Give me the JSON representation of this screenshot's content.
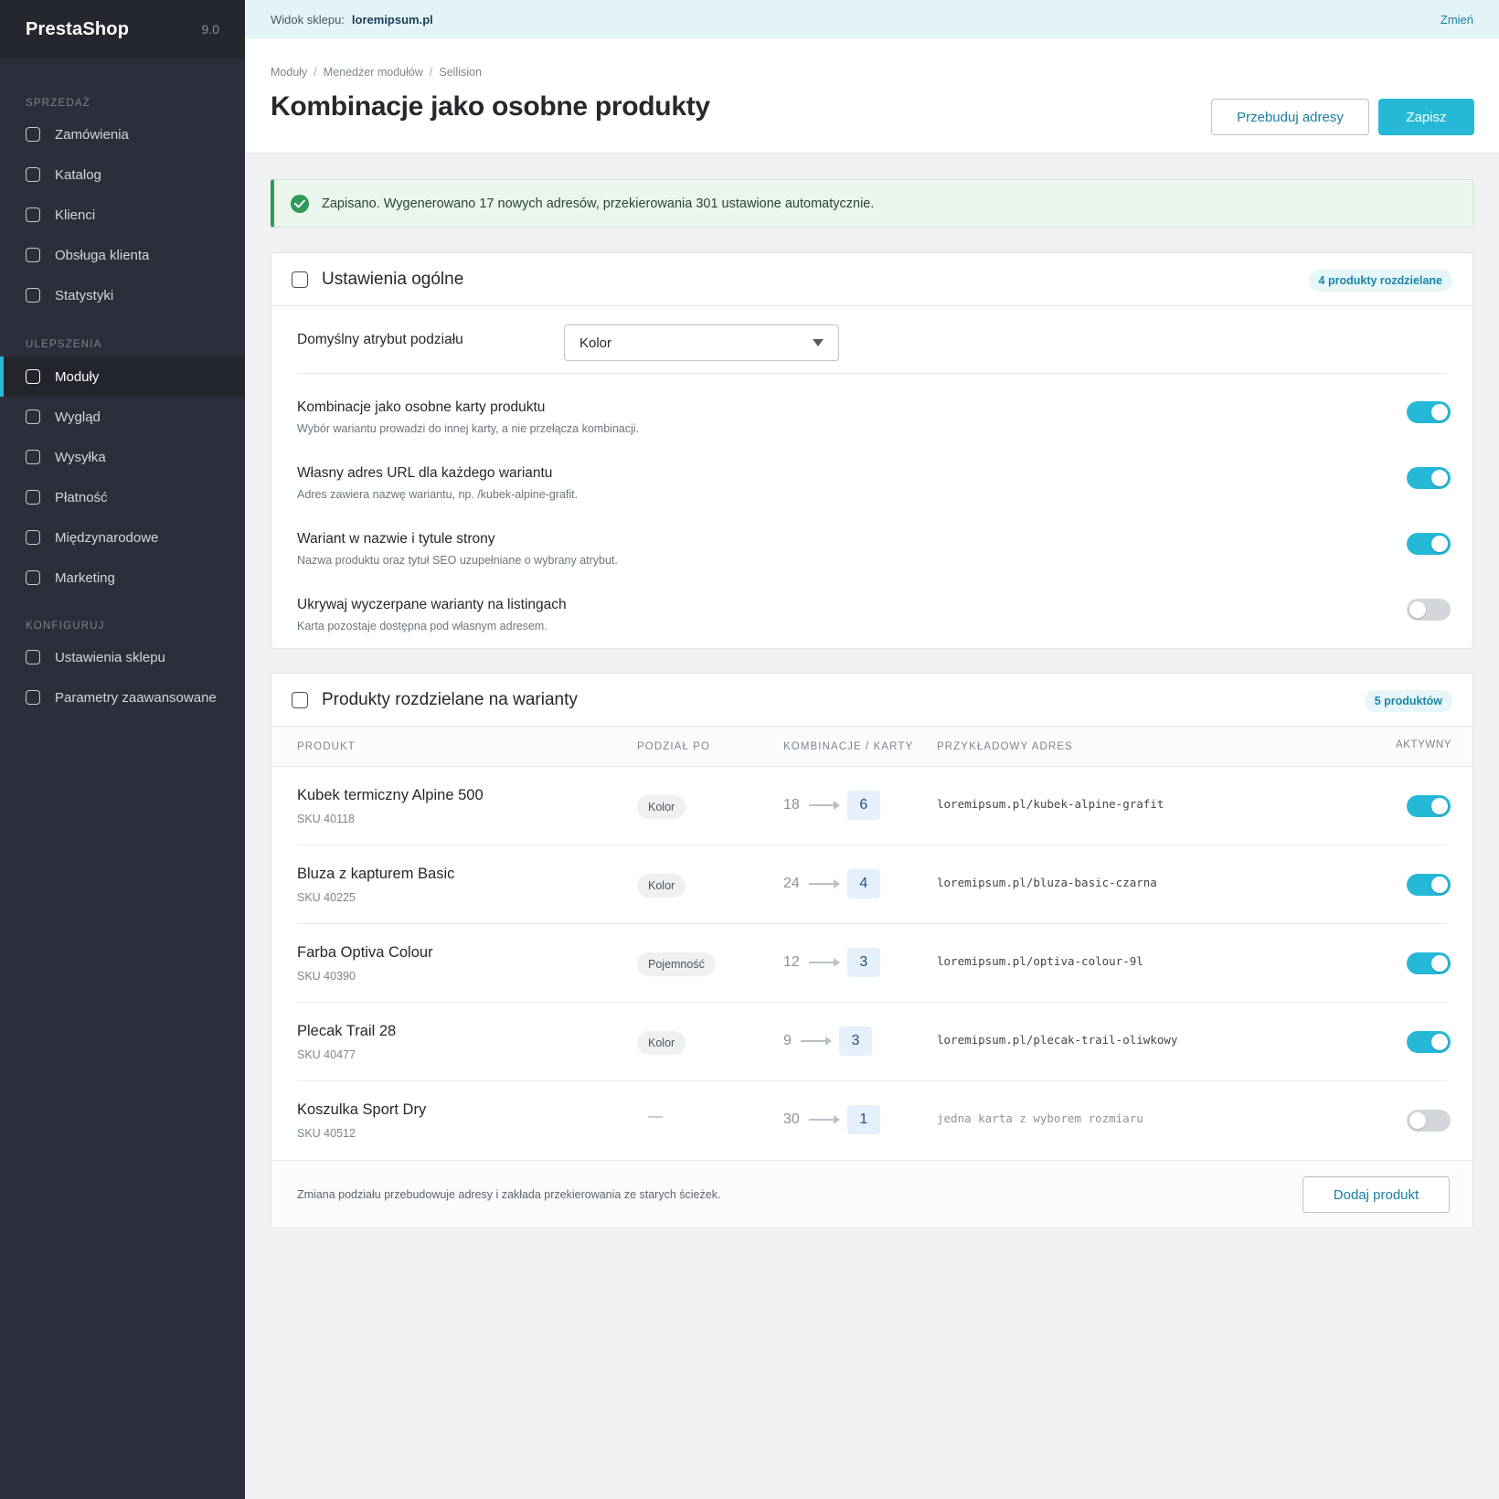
{
  "sidebar": {
    "brand": "PrestaShop",
    "version": "9.0",
    "sections": [
      {
        "title": "SPRZEDAŻ",
        "items": [
          "Zamówienia",
          "Katalog",
          "Klienci",
          "Obsługa klienta",
          "Statystyki"
        ]
      },
      {
        "title": "ULEPSZENIA",
        "items": [
          "Moduły",
          "Wygląd",
          "Wysyłka",
          "Płatność",
          "Międzynarodowe",
          "Marketing"
        ]
      },
      {
        "title": "KONFIGURUJ",
        "items": [
          "Ustawienia sklepu",
          "Parametry zaawansowane"
        ]
      }
    ],
    "active_item": "Moduły"
  },
  "topbar": {
    "label": "Widok sklepu:",
    "domain": "loremipsum.pl",
    "change": "Zmień"
  },
  "header": {
    "breadcrumb": [
      "Moduły",
      "Menedżer modułów",
      "Sellision"
    ],
    "title": "Kombinacje jako osobne produkty",
    "rebuild_button": "Przebuduj adresy",
    "save_button": "Zapisz"
  },
  "alert": {
    "text": "Zapisano. Wygenerowano 17 nowych adresów, przekierowania 301 ustawione automatycznie.",
    "color": "#2f9a5a"
  },
  "general": {
    "title": "Ustawienia ogólne",
    "badge": "4 produkty rozdzielane",
    "attribute_label": "Domyślny atrybut podziału",
    "attribute_value": "Kolor",
    "settings": [
      {
        "label": "Kombinacje jako osobne karty produktu",
        "desc": "Wybór wariantu prowadzi do innej karty, a nie przełącza kombinacji.",
        "enabled": true
      },
      {
        "label": "Własny adres URL dla każdego wariantu",
        "desc": "Adres zawiera nazwę wariantu, np. /kubek-alpine-grafit.",
        "enabled": true
      },
      {
        "label": "Wariant w nazwie i tytule strony",
        "desc": "Nazwa produktu oraz tytuł SEO uzupełniane o wybrany atrybut.",
        "enabled": true
      },
      {
        "label": "Ukrywaj wyczerpane warianty na listingach",
        "desc": "Karta pozostaje dostępna pod własnym adresem.",
        "enabled": false
      }
    ]
  },
  "products": {
    "title": "Produkty rozdzielane na warianty",
    "badge": "5 produktów",
    "columns": [
      "PRODUKT",
      "PODZIAŁ PO",
      "KOMBINACJE / KARTY",
      "PRZYKŁADOWY ADRES",
      "AKTYWNY"
    ],
    "rows": [
      {
        "name": "Kubek termiczny Alpine 500",
        "sku": "SKU 40118",
        "split": "Kolor",
        "combinations": "18",
        "cards": "6",
        "url": "loremipsum.pl/kubek-alpine-grafit",
        "active": true
      },
      {
        "name": "Bluza z kapturem Basic",
        "sku": "SKU 40225",
        "split": "Kolor",
        "combinations": "24",
        "cards": "4",
        "url": "loremipsum.pl/bluza-basic-czarna",
        "active": true
      },
      {
        "name": "Farba Optiva Colour",
        "sku": "SKU 40390",
        "split": "Pojemność",
        "combinations": "12",
        "cards": "3",
        "url": "loremipsum.pl/optiva-colour-9l",
        "active": true
      },
      {
        "name": "Plecak Trail 28",
        "sku": "SKU 40477",
        "split": "Kolor",
        "combinations": "9",
        "cards": "3",
        "url": "loremipsum.pl/plecak-trail-oliwkowy",
        "active": true
      },
      {
        "name": "Koszulka Sport Dry",
        "sku": "SKU 40512",
        "split": "—",
        "combinations": "30",
        "cards": "1",
        "url": "jedna karta z wyborem rozmiaru",
        "active": false
      }
    ],
    "footer_note": "Zmiana podziału przebudowuje adresy i zakłada przekierowania ze starych ścieżek.",
    "add_button": "Dodaj produkt"
  },
  "colors": {
    "accent": "#25b9d7",
    "sidebar": "#2c2f3b",
    "success": "#2f9a5a"
  }
}
